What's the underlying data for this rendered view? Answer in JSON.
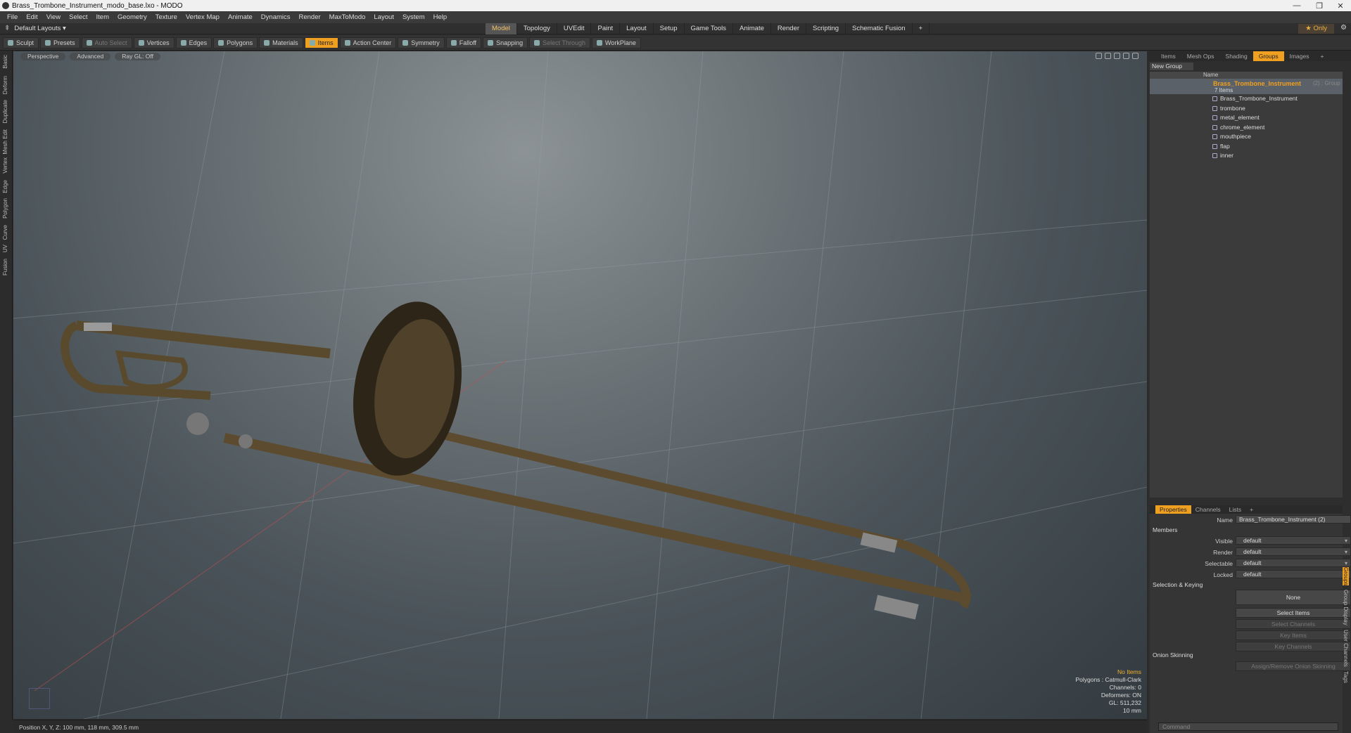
{
  "window": {
    "title": "Brass_Trombone_Instrument_modo_base.lxo - MODO",
    "controls": [
      "—",
      "❐",
      "✕"
    ]
  },
  "menu": [
    "File",
    "Edit",
    "View",
    "Select",
    "Item",
    "Geometry",
    "Texture",
    "Vertex Map",
    "Animate",
    "Dynamics",
    "Render",
    "MaxToModo",
    "Layout",
    "System",
    "Help"
  ],
  "layout": {
    "default_layouts": "Default Layouts ▾",
    "only": "★ Only"
  },
  "layout_tabs": [
    {
      "label": "Model",
      "active": true
    },
    {
      "label": "Topology"
    },
    {
      "label": "UVEdit"
    },
    {
      "label": "Paint"
    },
    {
      "label": "Layout"
    },
    {
      "label": "Setup"
    },
    {
      "label": "Game Tools"
    },
    {
      "label": "Animate"
    },
    {
      "label": "Render"
    },
    {
      "label": "Scripting"
    },
    {
      "label": "Schematic Fusion"
    },
    {
      "label": "+"
    }
  ],
  "toolbar": [
    {
      "label": "Sculpt",
      "name": "sculpt-button"
    },
    {
      "label": "Presets",
      "name": "presets-button"
    },
    {
      "label": "Auto Select",
      "name": "auto-select-button",
      "dim": true
    },
    {
      "label": "Vertices",
      "name": "vertices-button"
    },
    {
      "label": "Edges",
      "name": "edges-button"
    },
    {
      "label": "Polygons",
      "name": "polygons-button"
    },
    {
      "label": "Materials",
      "name": "materials-button"
    },
    {
      "label": "Items",
      "name": "items-button",
      "active": true
    },
    {
      "label": "Action Center",
      "name": "action-center-button"
    },
    {
      "label": "Symmetry",
      "name": "symmetry-button"
    },
    {
      "label": "Falloff",
      "name": "falloff-button"
    },
    {
      "label": "Snapping",
      "name": "snapping-button"
    },
    {
      "label": "Select Through",
      "name": "select-through-button",
      "dim": true
    },
    {
      "label": "WorkPlane",
      "name": "workplane-button"
    }
  ],
  "left_tabs": [
    "Basic",
    "Deform",
    "Duplicate",
    "Mesh Edit",
    "Vertex",
    "Edge",
    "Polygon",
    "Curve",
    "UV",
    "Fusion"
  ],
  "viewport": {
    "header": [
      "Perspective",
      "Advanced",
      "Ray GL: Off"
    ],
    "hud": {
      "warn": "No Items",
      "lines": [
        "Polygons : Catmull-Clark",
        "Channels: 0",
        "Deformers: ON",
        "GL: 511,232",
        "10 mm"
      ]
    }
  },
  "status": {
    "position": "Position X, Y, Z:  100 mm, 118 mm, 309.5 mm"
  },
  "right_tabs": [
    "Items",
    "Mesh Ops",
    "Shading",
    "Groups",
    "Images",
    "+"
  ],
  "groups": {
    "new_group": "New Group",
    "col_name": "Name",
    "group_name": "Brass_Trombone_Instrument",
    "group_extra": "(2) : Group",
    "count": "7 Items",
    "items": [
      "Brass_Trombone_Instrument",
      "trombone",
      "metal_element",
      "chrome_element",
      "mouthpiece",
      "flap",
      "inner"
    ]
  },
  "properties": {
    "tabs": [
      "Properties",
      "Channels",
      "Lists",
      "+"
    ],
    "name_label": "Name",
    "name_value": "Brass_Trombone_Instrument (2)",
    "members": "Members",
    "visible_label": "Visible",
    "visible": "default",
    "render_label": "Render",
    "render": "default",
    "selectable_label": "Selectable",
    "selectable": "default",
    "locked_label": "Locked",
    "locked": "default",
    "sel_key": "Selection & Keying",
    "none": "None",
    "select_items": "Select Items",
    "select_channels": "Select Channels",
    "key_items": "Key Items",
    "key_channels": "Key Channels",
    "onion": "Onion Skinning",
    "onion_btn": "Assign/Remove Onion Skinning",
    "side_tabs": [
      "Groups",
      "Group Display",
      "User Channels",
      "Tags"
    ],
    "command_placeholder": "Command"
  },
  "colors": {
    "accent": "#f0a020",
    "brass": "#6b5a3a"
  }
}
